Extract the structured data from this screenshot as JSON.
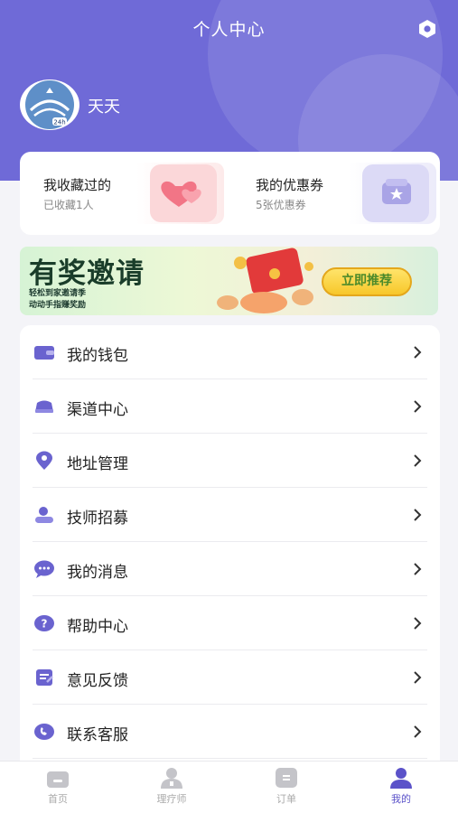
{
  "header": {
    "title": "个人中心",
    "settings_icon": "settings-icon",
    "bg_color": "#6f6ad7"
  },
  "user": {
    "name": "天天",
    "avatar_badge": "24h"
  },
  "cards": {
    "favorites": {
      "title": "我收藏过的",
      "subtitle": "已收藏1人",
      "icon": "heart-icon"
    },
    "coupons": {
      "title": "我的优惠券",
      "subtitle": "5张优惠券",
      "icon": "coupon-icon"
    }
  },
  "banner": {
    "title": "有奖邀请",
    "line1": "轻松到家邀请季",
    "line2": "动动手指赚奖励",
    "button": "立即推荐"
  },
  "menu": [
    {
      "label": "我的钱包",
      "icon": "wallet-icon"
    },
    {
      "label": "渠道中心",
      "icon": "channel-icon"
    },
    {
      "label": "地址管理",
      "icon": "location-icon"
    },
    {
      "label": "技师招募",
      "icon": "recruit-icon"
    },
    {
      "label": "我的消息",
      "icon": "message-icon"
    },
    {
      "label": "帮助中心",
      "icon": "help-icon"
    },
    {
      "label": "意见反馈",
      "icon": "feedback-icon"
    },
    {
      "label": "联系客服",
      "icon": "service-icon"
    }
  ],
  "tabbar": [
    {
      "label": "首页",
      "icon": "home-icon",
      "active": false
    },
    {
      "label": "理疗师",
      "icon": "therapist-icon",
      "active": false
    },
    {
      "label": "订单",
      "icon": "order-icon",
      "active": false
    },
    {
      "label": "我的",
      "icon": "profile-icon",
      "active": true
    }
  ],
  "colors": {
    "accent": "#5b52c9",
    "icon_tint": "#6a63cf"
  }
}
